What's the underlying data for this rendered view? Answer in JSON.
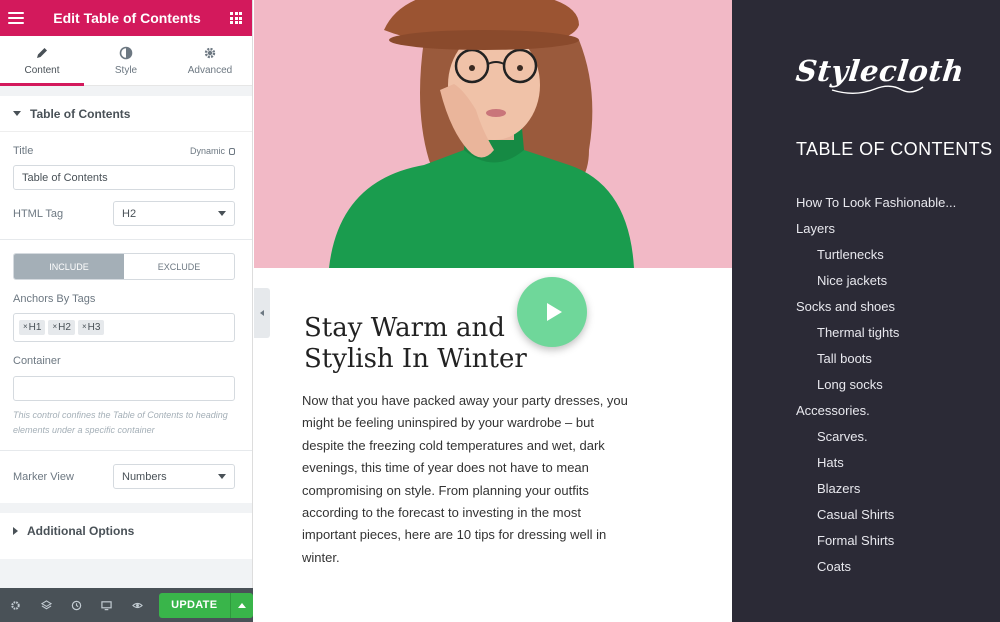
{
  "editor": {
    "header_title": "Edit Table of Contents",
    "tabs": [
      {
        "label": "Content",
        "icon": "pencil-icon"
      },
      {
        "label": "Style",
        "icon": "half-circle-icon"
      },
      {
        "label": "Advanced",
        "icon": "gear-icon"
      }
    ],
    "section_title": "Table of Contents",
    "title_label": "Title",
    "dynamic_label": "Dynamic",
    "title_value": "Table of Contents",
    "html_tag_label": "HTML Tag",
    "html_tag_value": "H2",
    "include_label": "INCLUDE",
    "exclude_label": "EXCLUDE",
    "anchors_label": "Anchors By Tags",
    "anchor_tags": [
      "H1",
      "H2",
      "H3"
    ],
    "container_label": "Container",
    "container_value": "",
    "container_note": "This control confines the Table of Contents to heading elements under a specific container",
    "marker_view_label": "Marker View",
    "marker_view_value": "Numbers",
    "additional_options_label": "Additional Options",
    "update_label": "UPDATE",
    "accent_color": "#d3195c",
    "update_color": "#39b54a"
  },
  "article": {
    "title": "Stay Warm and Stylish In Winter",
    "body": "Now that you have packed away your party dresses, you might be feeling uninspired by your wardrobe – but despite the freezing cold temperatures and wet, dark evenings, this time of year does not have to mean compromising on style. From planning your outfits according to the forecast to investing in the most important pieces, here are 10 tips for dressing well in winter.",
    "play_color": "#6fd79a"
  },
  "sidebar": {
    "logo_text": "Stylecloth",
    "toc_title": "TABLE OF CONTENTS",
    "toc_items": [
      {
        "label": "How To Look Fashionable...",
        "level": 1
      },
      {
        "label": "Layers",
        "level": 1
      },
      {
        "label": "Turtlenecks",
        "level": 2
      },
      {
        "label": "Nice jackets",
        "level": 2
      },
      {
        "label": "Socks and shoes",
        "level": 1
      },
      {
        "label": "Thermal tights",
        "level": 2
      },
      {
        "label": "Tall boots",
        "level": 2
      },
      {
        "label": "Long socks",
        "level": 2
      },
      {
        "label": "Accessories.",
        "level": 1
      },
      {
        "label": "Scarves.",
        "level": 2
      },
      {
        "label": "Hats",
        "level": 2
      },
      {
        "label": "Blazers",
        "level": 2
      },
      {
        "label": "Casual Shirts",
        "level": 2
      },
      {
        "label": "Formal Shirts",
        "level": 2
      },
      {
        "label": "Coats",
        "level": 2
      }
    ],
    "background_color": "#2b2a36"
  }
}
